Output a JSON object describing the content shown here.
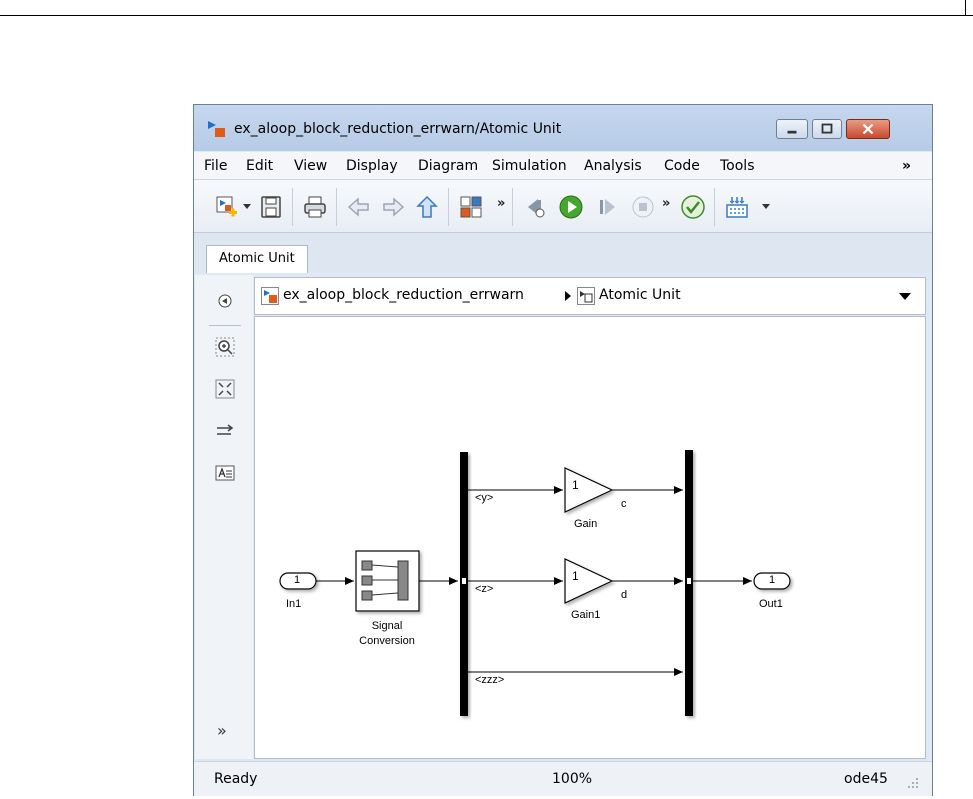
{
  "window": {
    "title": "ex_aloop_block_reduction_errwarn/Atomic Unit"
  },
  "menu": [
    "File",
    "Edit",
    "View",
    "Display",
    "Diagram",
    "Simulation",
    "Analysis",
    "Code",
    "Tools",
    "»"
  ],
  "toolbar": {
    "more_1": "»",
    "more_2": "»",
    "icons": [
      "new-model-icon",
      "save-icon",
      "print-icon",
      "back-icon",
      "forward-icon",
      "up-icon",
      "model-explorer-icon",
      "step-back-icon",
      "run-icon",
      "step-forward-icon",
      "stop-icon",
      "check-icon",
      "library-icon"
    ]
  },
  "tab": {
    "label": "Atomic Unit"
  },
  "address": {
    "model": "ex_aloop_block_reduction_errwarn",
    "subsystem": "Atomic Unit"
  },
  "left_panel": {
    "more": "»"
  },
  "diagram": {
    "in1": {
      "number": "1",
      "name": "In1"
    },
    "signal_conversion": {
      "name_line1": "Signal",
      "name_line2": "Conversion"
    },
    "gain": {
      "value": "1",
      "name": "Gain",
      "signal_out": "c"
    },
    "gain1": {
      "value": "1",
      "name": "Gain1",
      "signal_out": "d"
    },
    "out1": {
      "number": "1",
      "name": "Out1"
    },
    "signals": {
      "y": "<y>",
      "z": "<z>",
      "zzz": "<zzz>"
    }
  },
  "status": {
    "state": "Ready",
    "zoom": "100%",
    "solver": "ode45"
  }
}
